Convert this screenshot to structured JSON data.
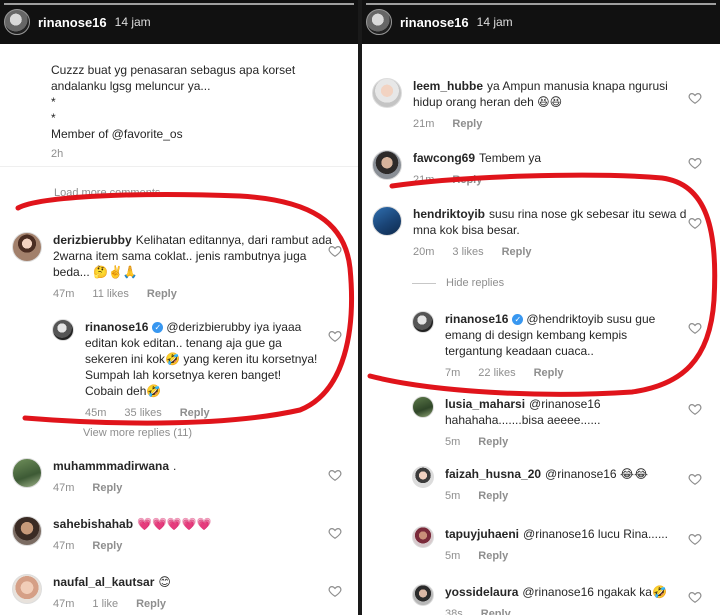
{
  "stories": [
    {
      "username": "rinanose16",
      "time_ago": "14 jam",
      "caption": {
        "lines": [
          "Cuzzz buat yg penasaran sebagus apa korset",
          "andalanku lgsg meluncur ya...",
          "*",
          "*",
          "Member of @favorite_os"
        ],
        "time": "2h"
      },
      "load_more": "Load more comments",
      "view_more_replies": "View more replies (11)",
      "comments": [
        {
          "user": "derizbierubby",
          "text": "Kelihatan editannya, dari rambut ada 2warna item sama coklat.. jenis rambutnya juga beda... 🤔✌️🙏",
          "time": "47m",
          "likes": "11 likes",
          "reply": "Reply"
        },
        {
          "user": "rinanose16",
          "text": "@derizbierubby iya iyaaa editan kok editan.. tenang aja gue ga sekeren ini kok🤣 yang keren itu korsetnya! Sumpah lah korsetnya keren banget! Cobain deh🤣",
          "time": "45m",
          "likes": "35 likes",
          "reply": "Reply",
          "verified": true
        },
        {
          "user": "muhammmadirwana",
          "text": ".",
          "time": "47m",
          "reply": "Reply"
        },
        {
          "user": "sahebishahab",
          "text": "💗💗💗💗💗",
          "time": "47m",
          "reply": "Reply"
        },
        {
          "user": "naufal_al_kautsar",
          "text": "😊",
          "time": "47m",
          "likes": "1 like",
          "reply": "Reply"
        }
      ]
    },
    {
      "username": "rinanose16",
      "time_ago": "14 jam",
      "hide_replies": "Hide replies",
      "comments": [
        {
          "user": "leem_hubbe",
          "text": "ya Ampun manusia knapa ngurusi hidup orang heran deh 😆😆",
          "time": "21m",
          "reply": "Reply"
        },
        {
          "user": "fawcong69",
          "text": "Tembem ya",
          "time": "21m",
          "reply": "Reply"
        },
        {
          "user": "hendriktoyib",
          "text": "susu rina nose gk sebesar itu sewa d mna kok bisa besar.",
          "time": "20m",
          "likes": "3 likes",
          "reply": "Reply"
        },
        {
          "user": "rinanose16",
          "text": "@hendriktoyib susu gue emang di design kembang kempis tergantung keadaan cuaca..",
          "time": "7m",
          "likes": "22 likes",
          "reply": "Reply",
          "verified": true
        },
        {
          "user": "lusia_maharsi",
          "text": "@rinanose16 hahahaha.......bisa aeeee......",
          "time": "5m",
          "reply": "Reply"
        },
        {
          "user": "faizah_husna_20",
          "text": "@rinanose16 😂😂",
          "time": "5m",
          "reply": "Reply"
        },
        {
          "user": "tapuyjuhaeni",
          "text": "@rinanose16 lucu Rina......",
          "time": "5m",
          "reply": "Reply"
        },
        {
          "user": "yossidelaura",
          "text": "@rinanose16 ngakak ka🤣",
          "time": "38s",
          "reply": "Reply"
        }
      ]
    }
  ],
  "colors": {
    "verified": "#3897f0",
    "annotation": "#e0141b",
    "meta": "#8e8e8e"
  },
  "icons": {
    "like": "heart-outline-icon",
    "verified": "verified-badge-icon"
  }
}
